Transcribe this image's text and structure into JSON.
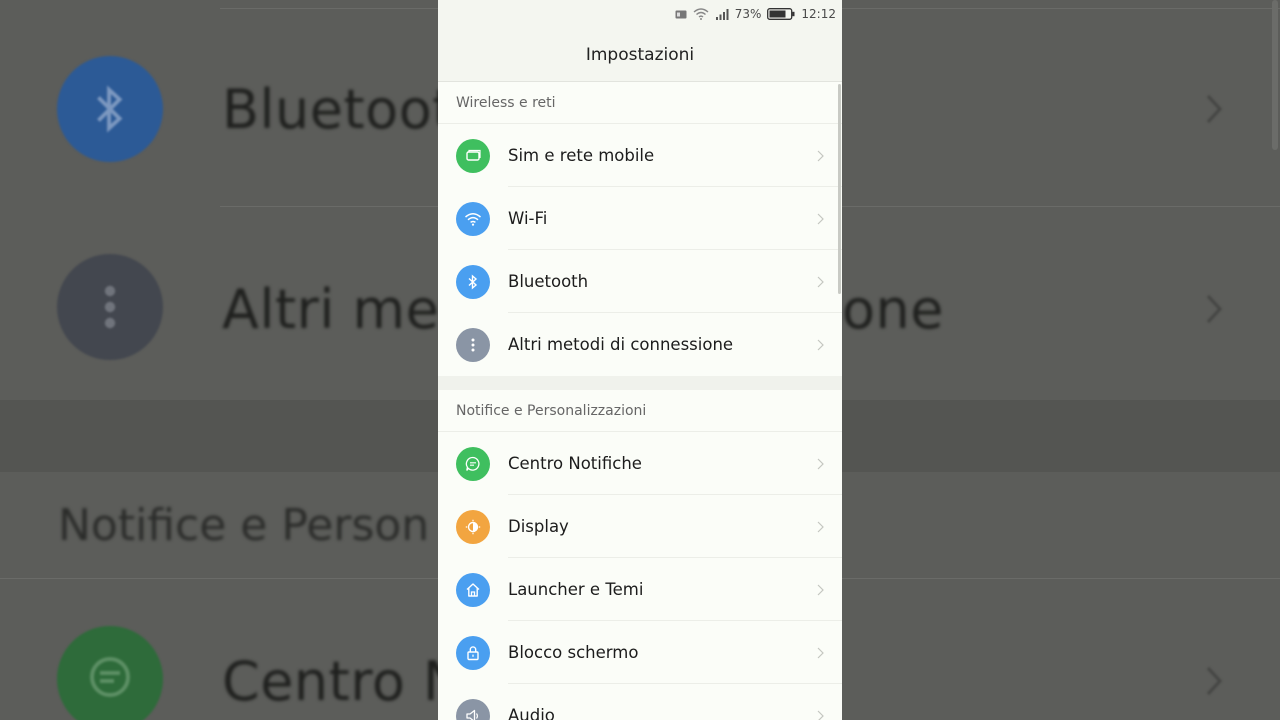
{
  "status_bar": {
    "battery_percent": "73%",
    "time": "12:12"
  },
  "header": {
    "title": "Impostazioni"
  },
  "sections": [
    {
      "title": "Wireless e reti",
      "items": [
        {
          "label": "Sim e rete mobile",
          "icon": "sim-card-icon",
          "color": "#3fbf5f"
        },
        {
          "label": "Wi-Fi",
          "icon": "wifi-icon",
          "color": "#4a9ff0"
        },
        {
          "label": "Bluetooth",
          "icon": "bluetooth-icon",
          "color": "#4a9ff0"
        },
        {
          "label": "Altri metodi di connessione",
          "icon": "more-vertical-icon",
          "color": "#8a95a5"
        }
      ]
    },
    {
      "title": "Notifice e Personalizzazioni",
      "items": [
        {
          "label": "Centro Notifiche",
          "icon": "chat-bubble-icon",
          "color": "#3fbf5f"
        },
        {
          "label": "Display",
          "icon": "brightness-icon",
          "color": "#f2a540"
        },
        {
          "label": "Launcher e Temi",
          "icon": "home-icon",
          "color": "#4a9ff0"
        },
        {
          "label": "Blocco schermo",
          "icon": "lock-icon",
          "color": "#4a9ff0"
        },
        {
          "label": "Audio",
          "icon": "speaker-icon",
          "color": "#8a95a5"
        }
      ]
    }
  ],
  "background": {
    "text_bluetooth": "Bluetoot",
    "text_altri": "Altri met",
    "text_altri_right": "one",
    "text_section": "Notifice e Person",
    "text_centro": "Centro N"
  }
}
